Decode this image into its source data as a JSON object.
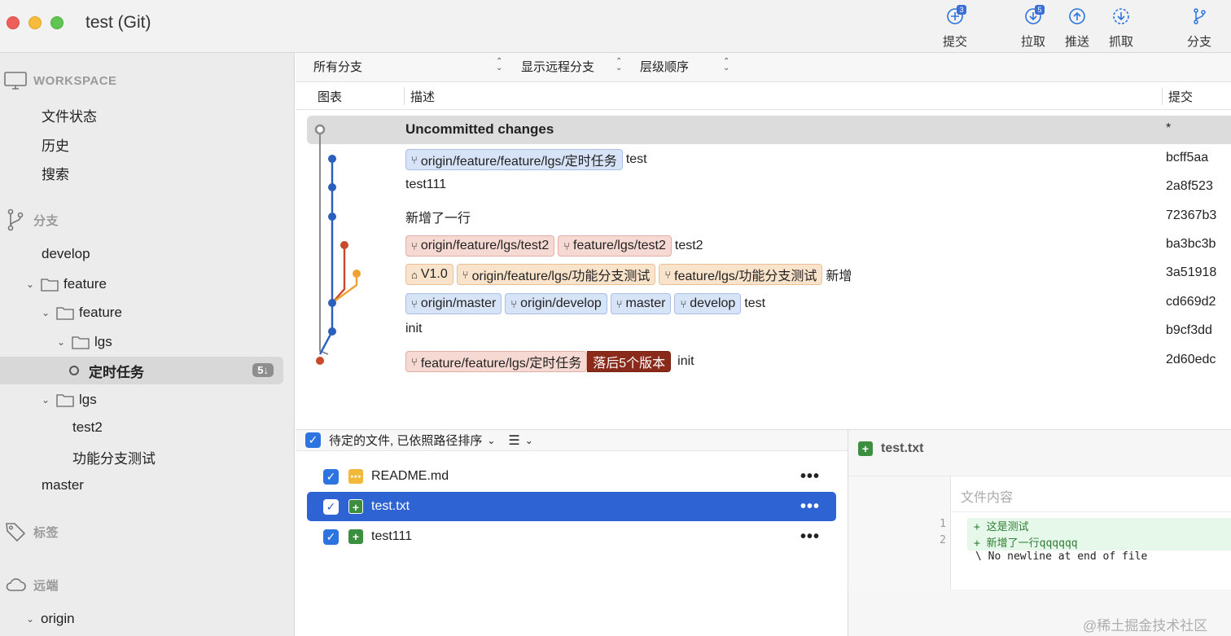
{
  "window": {
    "title": "test (Git)"
  },
  "toolbar": {
    "commit": {
      "label": "提交",
      "badge": "3"
    },
    "pull": {
      "label": "拉取",
      "badge": "5"
    },
    "push": {
      "label": "推送"
    },
    "fetch": {
      "label": "抓取"
    },
    "branch": {
      "label": "分支"
    }
  },
  "sidebar": {
    "workspace": {
      "title": "WORKSPACE",
      "items": [
        "文件状态",
        "历史",
        "搜索"
      ]
    },
    "branches": {
      "title": "分支",
      "develop": "develop",
      "feature1": "feature",
      "feature2": "feature",
      "lgs1": "lgs",
      "timer": "定时任务",
      "timer_badge": "5↓",
      "lgs2": "lgs",
      "test2": "test2",
      "funcbranch": "功能分支测试",
      "master": "master"
    },
    "tags": {
      "title": "标签"
    },
    "remotes": {
      "title": "远端",
      "origin": "origin"
    }
  },
  "filters": {
    "all_branches": "所有分支",
    "show_remote": "显示远程分支",
    "order": "层级顺序"
  },
  "columns": {
    "graph": "图表",
    "desc": "描述",
    "commit": "提交"
  },
  "commits": [
    {
      "desc": "Uncommitted changes",
      "hash": "*"
    },
    {
      "tags": [
        "origin/feature/feature/lgs/定时任务"
      ],
      "desc": "test",
      "hash": "bcff5aa"
    },
    {
      "desc": "test111",
      "hash": "2a8f523"
    },
    {
      "desc": "新增了一行",
      "hash": "72367b3"
    },
    {
      "tags": [
        "origin/feature/lgs/test2",
        "feature/lgs/test2"
      ],
      "desc": "test2",
      "hash": "ba3bc3b"
    },
    {
      "tags": [
        "V1.0",
        "origin/feature/lgs/功能分支测试",
        "feature/lgs/功能分支测试"
      ],
      "desc": "新增",
      "hash": "3a51918"
    },
    {
      "tags": [
        "origin/master",
        "origin/develop",
        "master",
        "develop"
      ],
      "desc": "test",
      "hash": "cd669d2"
    },
    {
      "desc": "init",
      "hash": "b9cf3dd"
    },
    {
      "tags": [
        "feature/feature/lgs/定时任务"
      ],
      "behind": "落后5个版本",
      "desc": "init",
      "hash": "2d60edc"
    }
  ],
  "staging": {
    "header": "待定的文件, 已依照路径排序",
    "files": [
      {
        "name": "README.md",
        "more": "•••"
      },
      {
        "name": "test.txt",
        "more": "•••"
      },
      {
        "name": "test111",
        "more": "•••"
      }
    ]
  },
  "diff": {
    "file": "test.txt",
    "header": "文件内容",
    "lines": [
      {
        "num": "1",
        "text": "+ 这是测试"
      },
      {
        "num": "2",
        "text": "+ 新增了一行qqqqqq"
      },
      {
        "num": "",
        "text": "\\  No newline at end of file"
      }
    ]
  },
  "watermark": "@稀土掘金技术社区",
  "colors": {
    "accent": "#2e63d3",
    "graph_blue": "#2b5fbd",
    "graph_red": "#c8492b",
    "graph_orange": "#f0a136",
    "graph_gray": "#8a8a8a"
  }
}
